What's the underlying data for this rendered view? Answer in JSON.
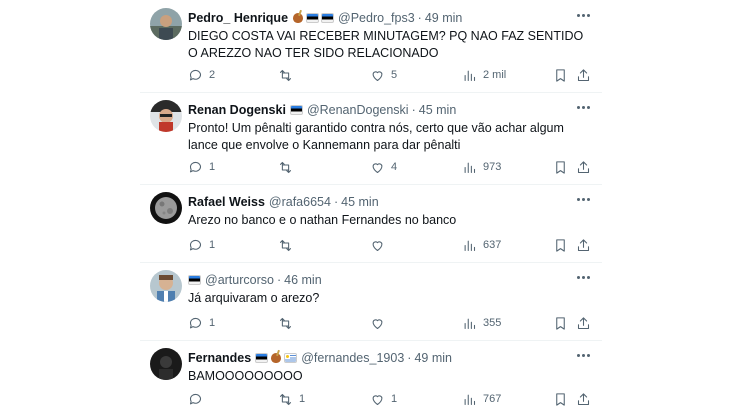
{
  "colors": {
    "text": "#0f1419",
    "muted": "#536471",
    "divider": "#eff3f4"
  },
  "tweets": [
    {
      "name": "Pedro_ Henrique",
      "handle": "@Pedro_fps3",
      "dot": "·",
      "time": "49 min",
      "badges": [
        "mate-icon",
        "estonia-flag-icon",
        "estonia-flag-icon"
      ],
      "text": "DIEGO COSTA VAI RECEBER MINUTAGEM? PQ NAO FAZ SENTIDO O AREZZO NAO TER SIDO RELACIONADO",
      "replies": "2",
      "retweets": "",
      "likes": "5",
      "views": "2 mil"
    },
    {
      "name": "Renan Dogenski",
      "handle": "@RenanDogenski",
      "dot": "·",
      "time": "45 min",
      "badges": [
        "estonia-flag-icon"
      ],
      "text": "Pronto! Um pênalti garantido contra nós, certo que vão achar algum lance que envolve o Kannemann para dar pênalti",
      "replies": "1",
      "retweets": "",
      "likes": "4",
      "views": "973"
    },
    {
      "name": "Rafael Weiss",
      "handle": "@rafa6654",
      "dot": "·",
      "time": "45 min",
      "badges": [],
      "text": "Arezo no banco e o nathan Fernandes no banco",
      "replies": "1",
      "retweets": "",
      "likes": "",
      "views": "637"
    },
    {
      "name": "",
      "handle": "@arturcorso",
      "dot": "·",
      "time": "46 min",
      "badges": [
        "estonia-flag-icon"
      ],
      "text": "Já arquivaram o arezo?",
      "replies": "1",
      "retweets": "",
      "likes": "",
      "views": "355"
    },
    {
      "name": "Fernandes",
      "handle": "@fernandes_1903",
      "dot": "·",
      "time": "49 min",
      "badges": [
        "estonia-flag-icon",
        "mate-icon",
        "uruguay-flag-icon"
      ],
      "text": "BAMOOOOOOOOO",
      "replies": "",
      "retweets": "1",
      "likes": "1",
      "views": "767"
    }
  ]
}
